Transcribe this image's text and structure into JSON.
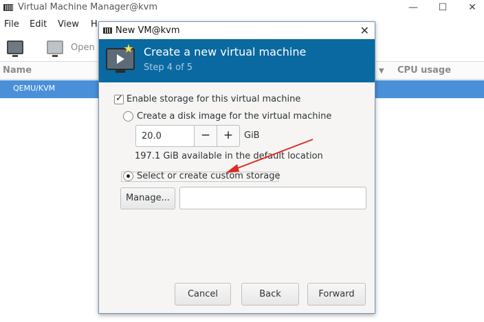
{
  "main_window": {
    "title": "Virtual Machine Manager@kvm",
    "controls": {
      "minimize": "—",
      "maximize": "☐",
      "close": "✕"
    },
    "menu": [
      "File",
      "Edit",
      "View",
      "H"
    ],
    "toolbar": {
      "open_label": "Open"
    },
    "columns": {
      "name": "Name",
      "cpu_usage": "CPU usage",
      "dropdown": "▼"
    },
    "rows": [
      "QEMU/KVM"
    ]
  },
  "dialog": {
    "title": "New VM@kvm",
    "close": "✕",
    "header": {
      "title": "Create a new virtual machine",
      "step": "Step 4 of 5"
    },
    "enable_storage": {
      "label": "Enable storage for this virtual machine",
      "checked": true
    },
    "disk_image": {
      "label": "Create a disk image for the virtual machine",
      "selected": false,
      "size_value": "20.0",
      "decrement": "−",
      "increment": "+",
      "unit": "GiB",
      "available": "197.1 GiB available in the default location"
    },
    "custom_storage": {
      "label": "Select or create custom storage",
      "selected": true,
      "manage_label": "Manage...",
      "path_value": ""
    },
    "buttons": {
      "cancel": "Cancel",
      "back": "Back",
      "forward": "Forward"
    }
  },
  "colors": {
    "header_bg": "#0a69a0",
    "selection": "#4a90d9",
    "annotation_arrow": "#e02a22"
  }
}
